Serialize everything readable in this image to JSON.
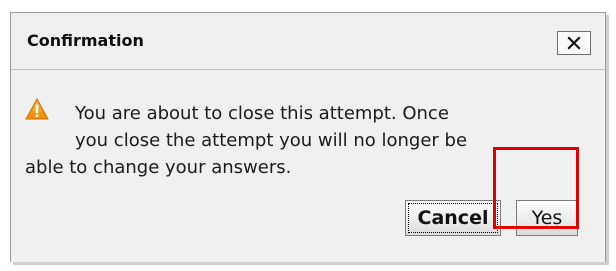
{
  "dialog": {
    "title": "Confirmation",
    "close_label": "×",
    "icon": "warning-triangle-icon",
    "message_lines": [
      "You are about to close this attempt. Once",
      "you close the attempt you will no longer be",
      "able to change your answers."
    ],
    "buttons": {
      "cancel": "Cancel",
      "yes": "Yes"
    }
  },
  "colors": {
    "background": "#f0f0f0",
    "highlight": "#e00000",
    "warning_fill": "#f59d00"
  }
}
